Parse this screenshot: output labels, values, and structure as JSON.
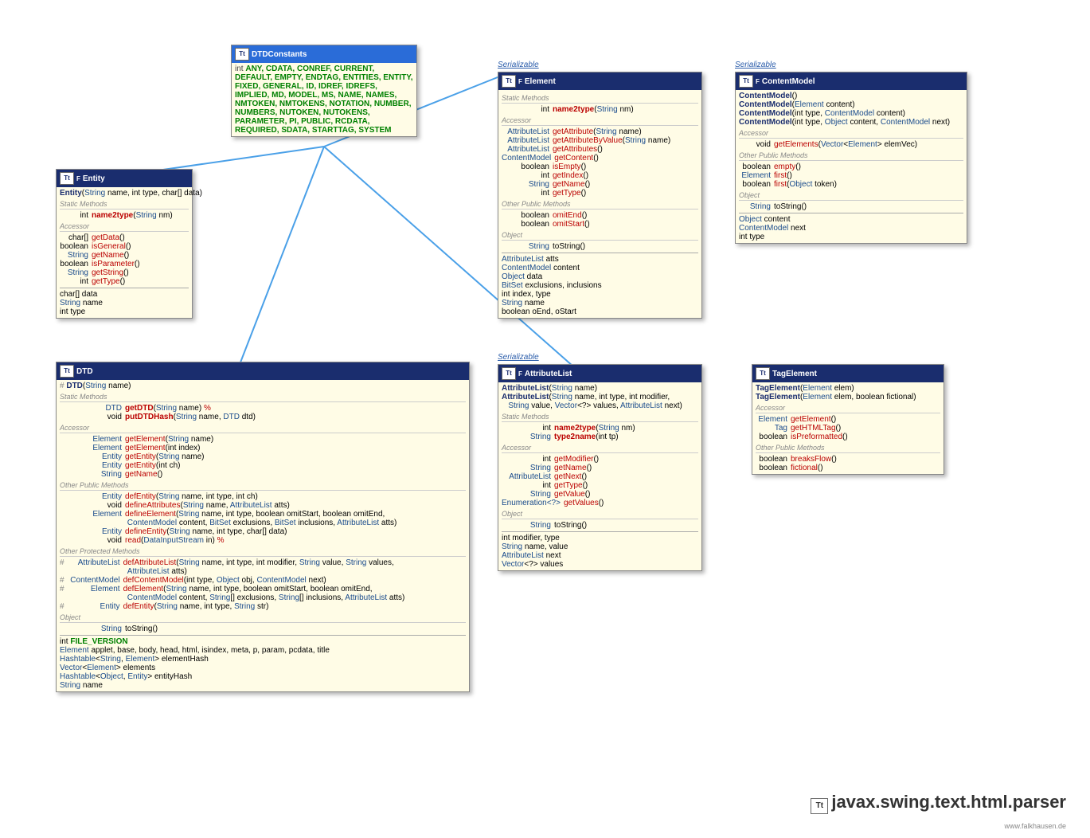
{
  "pkg": "javax.swing.text.html.parser",
  "footer": "www.falkhausen.de",
  "serial": "Serializable",
  "boxes": {
    "dtdconst": {
      "title": "DTDConstants",
      "constants": "ANY, CDATA, CONREF, CURRENT, DEFAULT, EMPTY, ENDTAG, ENTITIES, ENTITY, FIXED, GENERAL, ID, IDREF, IDREFS, IMPLIED, MD, MODEL, MS, NAME, NAMES, NMTOKEN, NMTOKENS, NOTATION, NUMBER, NUMBERS, NUTOKEN, NUTOKENS, PARAMETER, PI, PUBLIC, RCDATA, REQUIRED, SDATA, STARTTAG, SYSTEM"
    },
    "entity": {
      "title": "Entity",
      "ctor": "Entity",
      "ctorArgs": " (String name, int type, char[] data)",
      "static": "Static Methods",
      "n2t": "name2type",
      "n2tArg": " (String nm)",
      "acc": "Accessor",
      "m1": "getData",
      "m2": "isGeneral",
      "m3": "getName",
      "m4": "isParameter",
      "m5": "getString",
      "m6": "getType",
      "f1": "char[] data",
      "f2": "String name",
      "f3": "int type",
      "r1": "char[]",
      "r2": "boolean",
      "r3": "String",
      "r4": "int"
    },
    "dtd": {
      "title": "DTD",
      "ctor": "DTD",
      "ctorArg": " (String name)",
      "static": "Static Methods",
      "getDTD": "getDTD",
      "getDTDarg": " (String name) ",
      "putDTD": "putDTDHash",
      "putDTDarg": " (String name, DTD dtd)",
      "acc": "Accessor",
      "ge1": "getElement",
      "ge1a": " (String name)",
      "ge2": "getElement",
      "ge2a": " (int index)",
      "gen1": "getEntity",
      "gen1a": " (String name)",
      "gen2": "getEntity",
      "gen2a": " (int ch)",
      "gn": "getName",
      "opm": "Other Public Methods",
      "de1": "defEntity",
      "de1a": " (String name, int type, int ch)",
      "da": "defineAttributes",
      "daa": " (String name, AttributeList atts)",
      "del": "defineElement",
      "dela": " (String name, int type, boolean omitStart, boolean omitEnd,",
      "delb": " ContentModel content, BitSet exclusions, BitSet inclusions, AttributeList atts)",
      "den": "defineEntity",
      "dena": " (String name, int type, char[] data)",
      "rd": "read",
      "rda": " (DataInputStream in) ",
      "oprot": "Other Protected Methods",
      "dal": "defAttributeList",
      "dala": " (String name, int type, int modifier, String value, String values,",
      "dalb": " AttributeList atts)",
      "dcm": "defContentModel",
      "dcma": " (int type, Object obj, ContentModel next)",
      "delm": "defElement",
      "delma": " (String name, int type, boolean omitStart, boolean omitEnd,",
      "delmb": " ContentModel content, String[] exclusions, String[] inclusions, AttributeList atts)",
      "den2": "defEntity",
      "den2a": " (String name, int type, String str)",
      "obj": "Object",
      "ts": "toString",
      "fv": "FILE_VERSION",
      "f1": "Element applet, base, body, head, html, isindex, meta, p, param, pcdata, title",
      "f2": "Hashtable<String, Element> elementHash",
      "f3": "Vector<Element> elements",
      "f4": "Hashtable<Object, Entity> entityHash",
      "f5": "String name"
    },
    "element": {
      "title": "Element",
      "static": "Static Methods",
      "n2t": "name2type",
      "n2ta": " (String nm)",
      "acc": "Accessor",
      "ga": "getAttribute",
      "gaa": " (String name)",
      "gav": "getAttributeByValue",
      "gava": " (String name)",
      "gas": "getAttributes",
      "gc": "getContent",
      "ie": "isEmpty",
      "gi": "getIndex",
      "gn": "getName",
      "gt": "getType",
      "opm": "Other Public Methods",
      "oe": "omitEnd",
      "os": "omitStart",
      "obj": "Object",
      "ts": "toString",
      "f1": "AttributeList atts",
      "f2": "ContentModel content",
      "f3": "Object data",
      "f4": "BitSet exclusions, inclusions",
      "f5": "int index, type",
      "f6": "String name",
      "f7": "boolean oEnd, oStart"
    },
    "attrlist": {
      "title": "AttributeList",
      "ctor": "AttributeList",
      "ca1": " (String name)",
      "ca2": " (String name, int type, int modifier,",
      "ca2b": " String value, Vector<?> values, AttributeList next)",
      "static": "Static Methods",
      "n2t": "name2type",
      "n2ta": " (String nm)",
      "t2n": "type2name",
      "t2na": " (int tp)",
      "acc": "Accessor",
      "gm": "getModifier",
      "gn": "getName",
      "gnx": "getNext",
      "gt": "getType",
      "gv": "getValue",
      "gvs": "getValues",
      "obj": "Object",
      "ts": "toString",
      "f1": "int modifier, type",
      "f2": "String name, value",
      "f3": "AttributeList next",
      "f4": "Vector<?> values"
    },
    "cm": {
      "title": "ContentModel",
      "ctor": "ContentModel",
      "c1": " ()",
      "c2": " (Element content)",
      "c3": " (int type, ContentModel content)",
      "c4": " (int type, Object content, ContentModel next)",
      "acc": "Accessor",
      "ge": "getElements",
      "gea": " (Vector<Element> elemVec)",
      "opm": "Other Public Methods",
      "em": "empty",
      "fi": "first",
      "fia": " ()",
      "fi2": "first",
      "fi2a": " (Object token)",
      "obj": "Object",
      "ts": "toString",
      "f1": "Object content",
      "f2": "ContentModel next",
      "f3": "int type"
    },
    "te": {
      "title": "TagElement",
      "ctor": "TagElement",
      "c1": " (Element elem)",
      "c2": " (Element elem, boolean fictional)",
      "acc": "Accessor",
      "ge": "getElement",
      "gh": "getHTMLTag",
      "ip": "isPreformatted",
      "opm": "Other Public Methods",
      "bf": "breaksFlow",
      "fc": "fictional"
    }
  }
}
